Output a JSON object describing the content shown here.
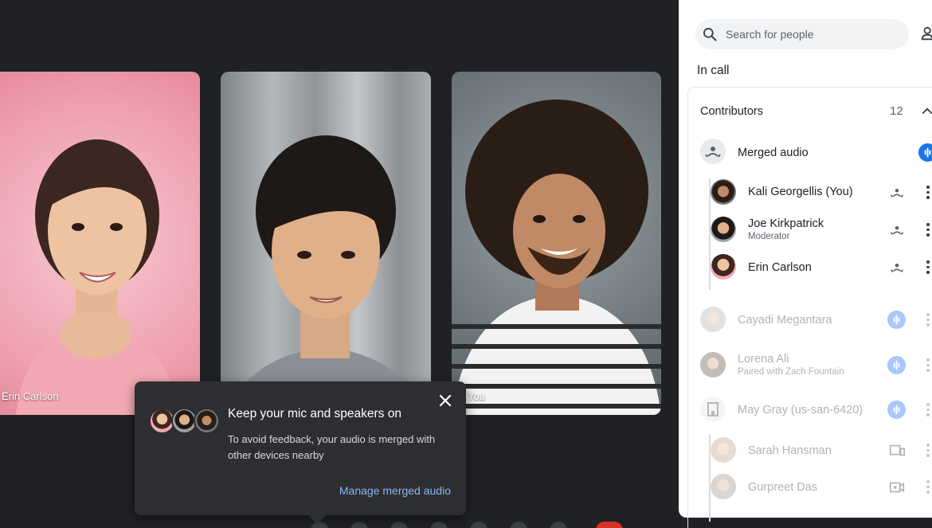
{
  "tiles": [
    {
      "name": "Erin Carlson"
    },
    {
      "name": ""
    },
    {
      "name": "You"
    }
  ],
  "popup": {
    "title": "Keep your mic and speakers on",
    "body": "To avoid feedback, your audio is merged with other devices nearby",
    "link": "Manage merged audio"
  },
  "panel": {
    "search_placeholder": "Search for people",
    "section_title": "In call",
    "contributors_label": "Contributors",
    "contributors_count": "12",
    "merged": {
      "label": "Merged audio"
    },
    "merged_members": [
      {
        "name": "Kali Georgellis (You)",
        "sub": ""
      },
      {
        "name": "Joe Kirkpatrick",
        "sub": "Moderator"
      },
      {
        "name": "Erin Carlson",
        "sub": ""
      }
    ],
    "others": [
      {
        "name": "Cayadi Megantara",
        "sub": ""
      },
      {
        "name": "Lorena Ali",
        "sub": "Paired with  Zach Fountain"
      },
      {
        "name": "May Gray (us-san-6420)",
        "sub": ""
      }
    ],
    "room_members": [
      {
        "name": "Sarah Hansman",
        "icon": "device-icon"
      },
      {
        "name": "Gurpreet Das",
        "icon": "video-icon"
      }
    ]
  },
  "colors": {
    "accent": "#1a73e8",
    "link": "#8ab4f8",
    "bg": "#202124"
  }
}
